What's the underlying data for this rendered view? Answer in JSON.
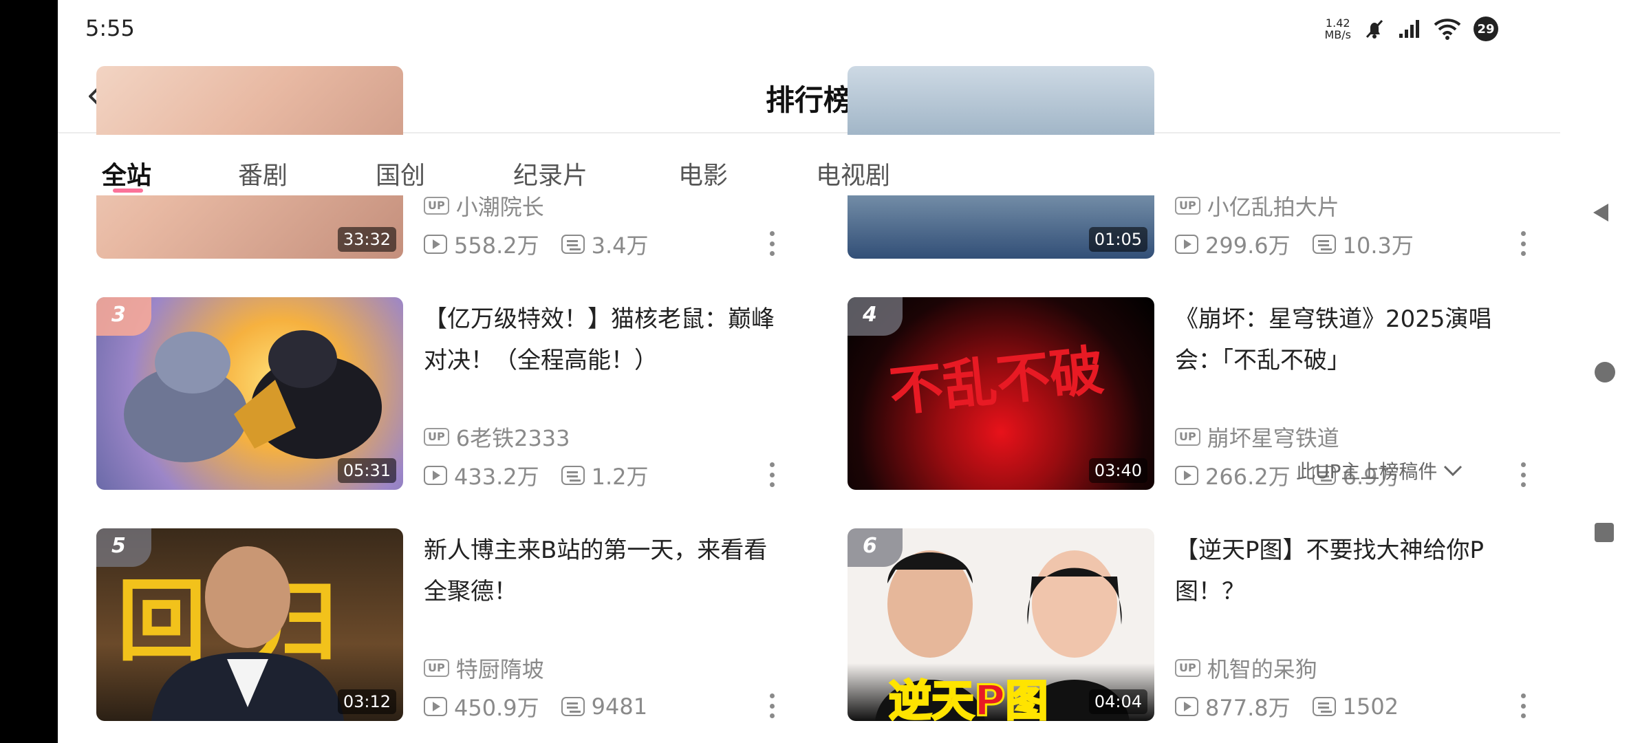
{
  "status_bar": {
    "time": "5:55",
    "net_speed_value": "1.42",
    "net_speed_unit": "MB/s",
    "battery": "29"
  },
  "header": {
    "title": "排行榜"
  },
  "tabs": [
    {
      "label": "全站",
      "active": true
    },
    {
      "label": "番剧",
      "active": false
    },
    {
      "label": "国创",
      "active": false
    },
    {
      "label": "纪录片",
      "active": false
    },
    {
      "label": "电影",
      "active": false
    },
    {
      "label": "电视剧",
      "active": false
    }
  ],
  "videos": [
    {
      "rank": "",
      "title": "",
      "author": "小潮院长",
      "views": "558.2万",
      "danmaku": "3.4万",
      "duration": "33:32"
    },
    {
      "rank": "",
      "title": "",
      "author": "小亿乱拍大片",
      "views": "299.6万",
      "danmaku": "10.3万",
      "duration": "01:05"
    },
    {
      "rank": "3",
      "title": "【亿万级特效！】猫核老鼠：巅峰对决！（全程高能！）",
      "author": "6老铁2333",
      "views": "433.2万",
      "danmaku": "1.2万",
      "duration": "05:31"
    },
    {
      "rank": "4",
      "title": "《崩坏：星穹铁道》2025演唱会：「不乱不破」",
      "author": "崩坏星穹铁道",
      "views": "266.2万",
      "danmaku": "6.9万",
      "duration": "03:40"
    },
    {
      "rank": "5",
      "title": "新人博主来B站的第一天，来看看全聚德！",
      "author": "特厨隋坡",
      "views": "450.9万",
      "danmaku": "9481",
      "duration": "03:12"
    },
    {
      "rank": "6",
      "title": "【逆天P图】不要找大神给你P图！？",
      "author": "机智的呆狗",
      "views": "877.8万",
      "danmaku": "1502",
      "duration": "04:04"
    }
  ],
  "overlay": {
    "text": "此UP主上榜稿件"
  },
  "thumb_text": {
    "video4_art": "不乱不破",
    "video5_art": "回归",
    "video6_art": "逆天P图",
    "up_badge": "UP"
  }
}
